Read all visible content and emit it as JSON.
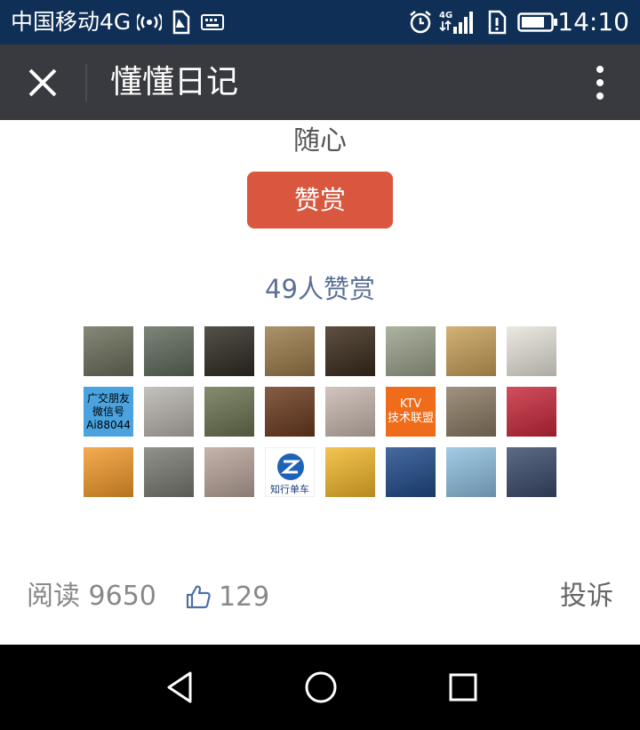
{
  "status_bar": {
    "carrier": "中国移动4G",
    "network_badge": "4G",
    "time": "14:10",
    "icons": [
      "hotspot-icon",
      "sim-alert-icon",
      "keyboard-icon",
      "alarm-icon",
      "signal-icon",
      "sim-card-icon",
      "battery-icon"
    ]
  },
  "titlebar": {
    "title": "懂懂日记",
    "close_icon": "close-icon",
    "more_icon": "more-vertical-icon"
  },
  "article": {
    "caption": "随心",
    "reward_label": "赞赏",
    "reward_count_label": "49人赞赏",
    "reward_color": "#d9573f",
    "avatars": [
      {
        "kind": "photo",
        "color": "#6b6e5a"
      },
      {
        "kind": "photo",
        "color": "#5e6a5a"
      },
      {
        "kind": "photo",
        "color": "#2f2b22"
      },
      {
        "kind": "photo",
        "color": "#9b7b4a"
      },
      {
        "kind": "photo",
        "color": "#3a2a1a"
      },
      {
        "kind": "photo",
        "color": "#9aa28a"
      },
      {
        "kind": "photo",
        "color": "#c9a05a"
      },
      {
        "kind": "photo",
        "color": "#e8e4dc"
      },
      {
        "kind": "text",
        "color": "#4aa3df",
        "lines": [
          "广交朋友",
          "微信号",
          "Ai88044"
        ]
      },
      {
        "kind": "photo",
        "color": "#b8b4ae"
      },
      {
        "kind": "photo",
        "color": "#6a7350"
      },
      {
        "kind": "photo",
        "color": "#6b3a1e"
      },
      {
        "kind": "photo",
        "color": "#c8b8b0"
      },
      {
        "kind": "text",
        "color": "#ef6c1a",
        "lines": [
          "KTV",
          "技术联盟"
        ]
      },
      {
        "kind": "photo",
        "color": "#8a7a62"
      },
      {
        "kind": "photo",
        "color": "#c8283a"
      },
      {
        "kind": "photo",
        "color": "#f39a2a"
      },
      {
        "kind": "photo",
        "color": "#7a7a72"
      },
      {
        "kind": "photo",
        "color": "#b8a49a"
      },
      {
        "kind": "text",
        "color": "#ffffff",
        "lines": [
          "知行单车"
        ]
      },
      {
        "kind": "photo",
        "color": "#f2b82a"
      },
      {
        "kind": "photo",
        "color": "#1e4a8a"
      },
      {
        "kind": "photo",
        "color": "#8ec0e0"
      },
      {
        "kind": "photo",
        "color": "#3a4a6a"
      }
    ]
  },
  "footer": {
    "read_label": "阅读 9650",
    "like_count": "129",
    "report_label": "投诉"
  },
  "navbar": {
    "back_icon": "back-triangle-icon",
    "home_icon": "home-circle-icon",
    "recents_icon": "recents-square-icon"
  }
}
